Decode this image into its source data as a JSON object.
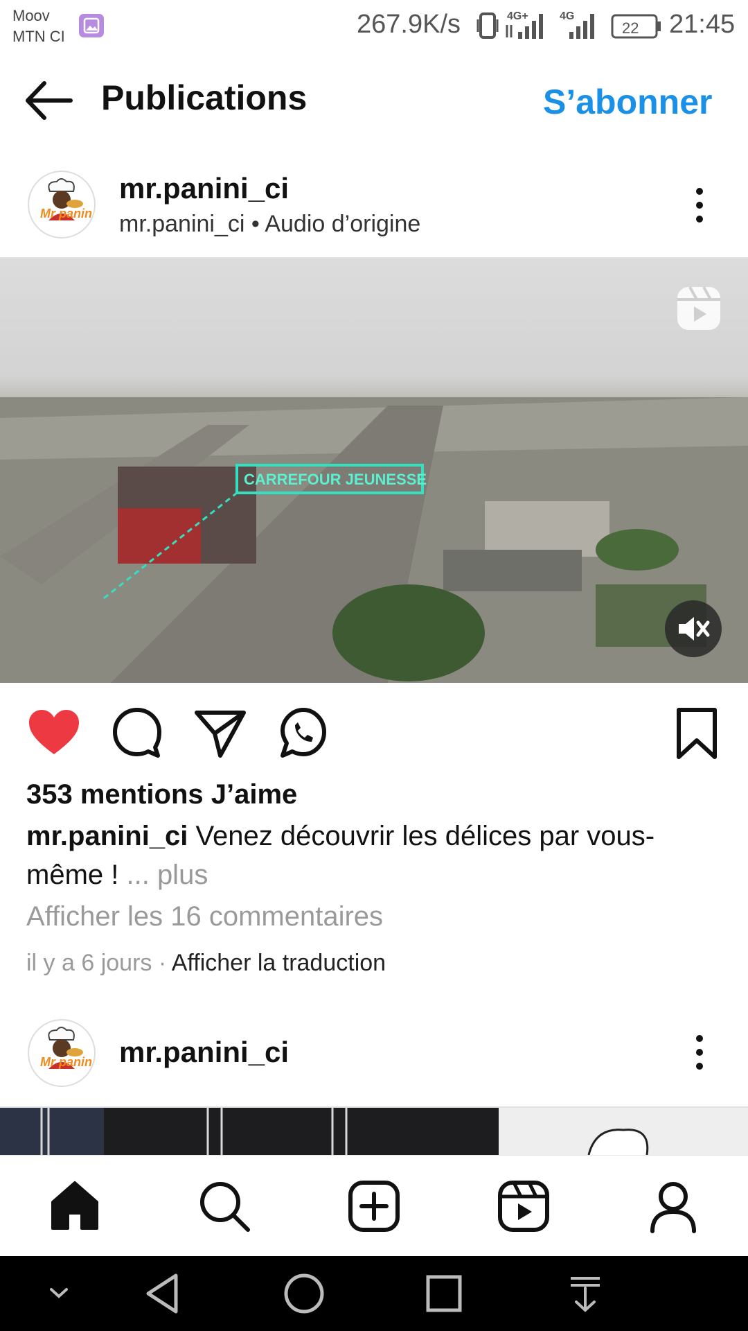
{
  "status_bar": {
    "carrier_line1": "Moov",
    "carrier_line2": "MTN CI",
    "net_speed": "267.9K/s",
    "battery": "22",
    "time": "21:45",
    "icons": [
      "gallery-icon",
      "vibrate-icon",
      "signal-4g-plus-icon",
      "signal-4g-icon",
      "battery-icon"
    ]
  },
  "header": {
    "title": "Publications",
    "follow_label": "S’abonner"
  },
  "post": {
    "username": "mr.panini_ci",
    "audio_line": "mr.panini_ci • Audio d’origine",
    "likes_text": "353 mentions J’aime",
    "caption_user": "mr.panini_ci",
    "caption_text": " Venez découvrir les délices par vous-même ! ",
    "more_label": "... plus",
    "comments_link": "Afficher les 16 commentaires",
    "time_ago": "il y a 6 jours",
    "separator": " · ",
    "translate_label": "Afficher la traduction",
    "liked": true,
    "muted": true,
    "video_overlay_text": "CARREFOUR JEUNESSE"
  },
  "next_post": {
    "username": "mr.panini_ci"
  },
  "avatar_brand": "Mr panini",
  "colors": {
    "accent": "#1a91e6",
    "like_red": "#ed3a42",
    "text_primary": "#111111",
    "text_muted": "#9a9a9a"
  },
  "bottom_nav": [
    "home-icon",
    "search-icon",
    "add-post-icon",
    "reels-icon",
    "profile-icon"
  ],
  "system_nav": [
    "collapse-icon",
    "back-icon",
    "home-circle-icon",
    "recents-icon",
    "notification-shade-icon"
  ]
}
